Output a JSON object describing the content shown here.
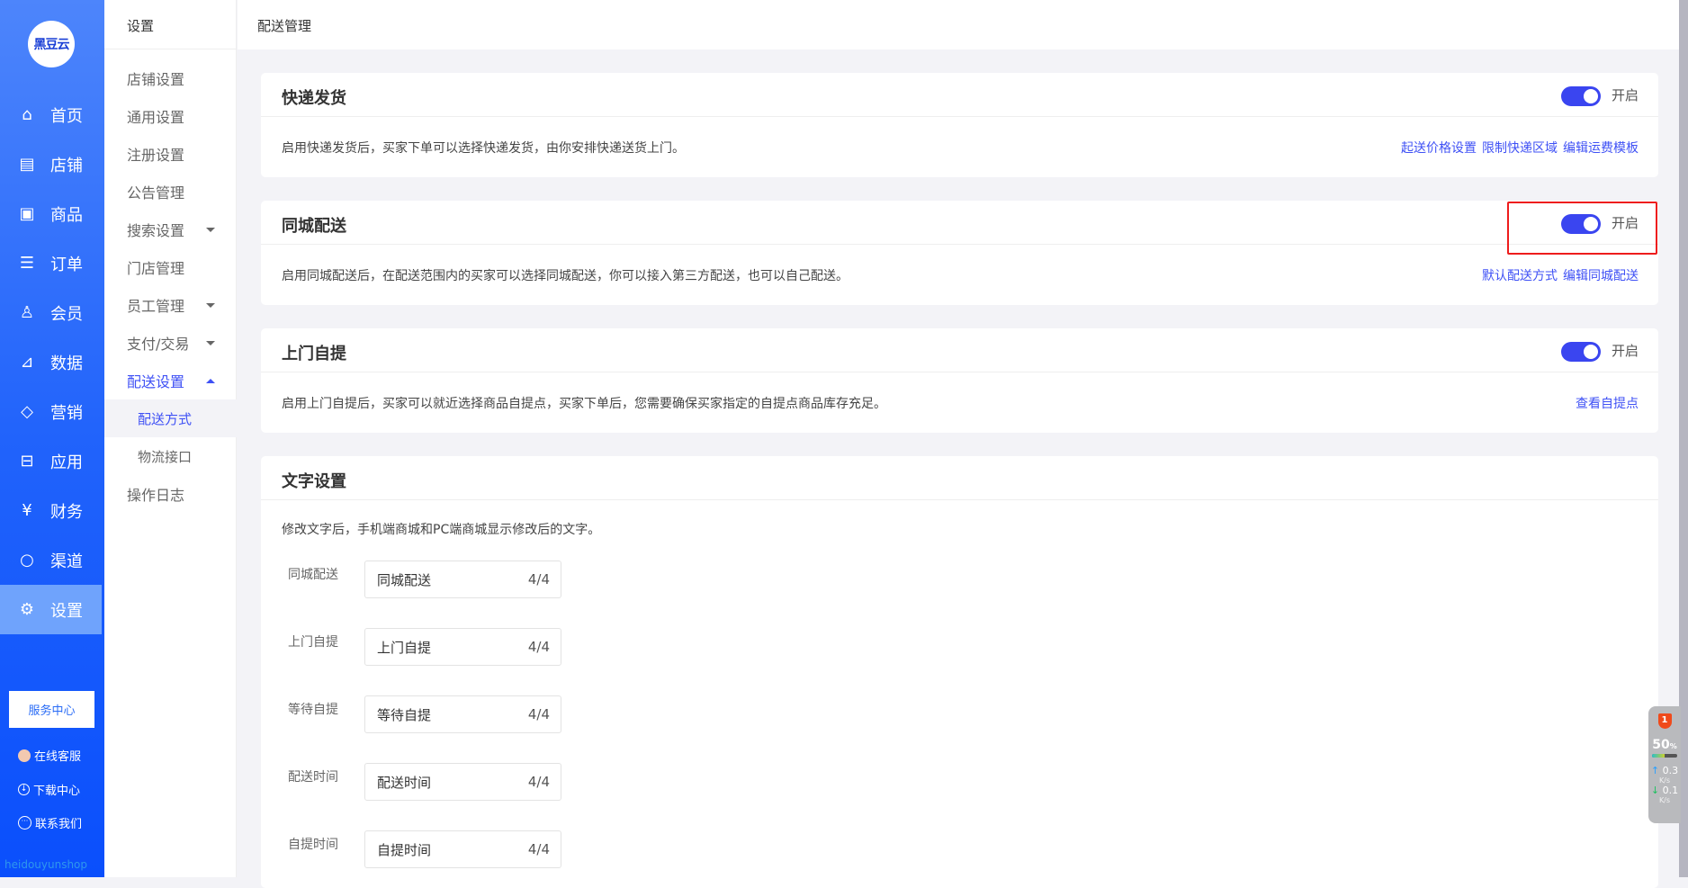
{
  "sidebar": {
    "logo": "黑豆云",
    "items": [
      {
        "label": "首页",
        "icon": "home-icon"
      },
      {
        "label": "店铺",
        "icon": "store-icon"
      },
      {
        "label": "商品",
        "icon": "goods-icon"
      },
      {
        "label": "订单",
        "icon": "order-icon"
      },
      {
        "label": "会员",
        "icon": "user-icon"
      },
      {
        "label": "数据",
        "icon": "chart-icon"
      },
      {
        "label": "营销",
        "icon": "tag-icon"
      },
      {
        "label": "应用",
        "icon": "box-icon"
      },
      {
        "label": "财务",
        "icon": "finance-icon"
      },
      {
        "label": "渠道",
        "icon": "channel-icon"
      },
      {
        "label": "设置",
        "icon": "gear-icon"
      }
    ],
    "service_center": "服务中心",
    "online_service": "在线客服",
    "download_center": "下载中心",
    "contact_us": "联系我们",
    "watermark": "heidouyunshop"
  },
  "submenu": {
    "title": "设置",
    "items": [
      "店铺设置",
      "通用设置",
      "注册设置",
      "公告管理",
      "搜索设置",
      "门店管理",
      "员工管理",
      "支付/交易",
      "配送设置",
      "配送方式",
      "物流接口",
      "操作日志"
    ]
  },
  "header": {
    "title": "配送管理"
  },
  "cards": [
    {
      "title": "快递发货",
      "toggle_label": "开启",
      "enabled": true,
      "desc": "启用快递发货后，买家下单可以选择快递发货，由你安排快递送货上门。",
      "links": [
        "起送价格设置",
        "限制快递区域",
        "编辑运费模板"
      ]
    },
    {
      "title": "同城配送",
      "toggle_label": "开启",
      "enabled": true,
      "desc": "启用同城配送后，在配送范围内的买家可以选择同城配送，你可以接入第三方配送，也可以自己配送。",
      "links": [
        "默认配送方式",
        "编辑同城配送"
      ]
    },
    {
      "title": "上门自提",
      "toggle_label": "开启",
      "enabled": true,
      "desc": "启用上门自提后，买家可以就近选择商品自提点，买家下单后，您需要确保买家指定的自提点商品库存充足。",
      "links": [
        "查看自提点"
      ]
    }
  ],
  "text_settings": {
    "title": "文字设置",
    "desc": "修改文字后，手机端商城和PC端商城显示修改后的文字。",
    "rows": [
      {
        "label": "同城配送",
        "value": "同城配送",
        "count": "4/4"
      },
      {
        "label": "上门自提",
        "value": "上门自提",
        "count": "4/4"
      },
      {
        "label": "等待自提",
        "value": "等待自提",
        "count": "4/4"
      },
      {
        "label": "配送时间",
        "value": "配送时间",
        "count": "4/4"
      },
      {
        "label": "自提时间",
        "value": "自提时间",
        "count": "4/4"
      }
    ]
  },
  "widget": {
    "badge": "1",
    "percent": "50",
    "percent_unit": "%",
    "up": "0.3",
    "down": "0.1",
    "unit": "K/s"
  },
  "colors": {
    "accent": "#3f51f5",
    "sidebar": "#2163fb",
    "highlight": "#ee1c1c"
  }
}
